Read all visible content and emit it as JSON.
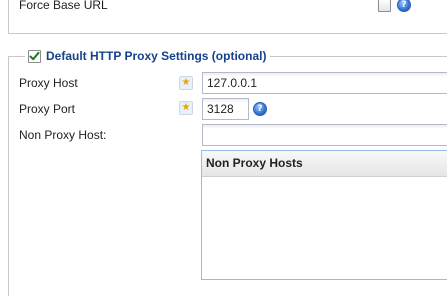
{
  "force_base_url": {
    "label": "Force Base URL",
    "checked": false
  },
  "proxy_section": {
    "title": "Default HTTP Proxy Settings (optional)",
    "enabled": true
  },
  "proxy_host": {
    "label": "Proxy Host",
    "value": "127.0.0.1"
  },
  "proxy_port": {
    "label": "Proxy Port",
    "value": "3128"
  },
  "non_proxy_host": {
    "label": "Non Proxy Host:",
    "value": ""
  },
  "non_proxy_grid": {
    "column_header": "Non Proxy Hosts",
    "rows": []
  },
  "colors": {
    "legend_text": "#15428b",
    "help_icon": "#3a78d6",
    "required_star": "#e0a800"
  },
  "icons": {
    "help": "help-icon",
    "required": "required-star-icon",
    "checkbox_checked": "checkmark-icon"
  }
}
